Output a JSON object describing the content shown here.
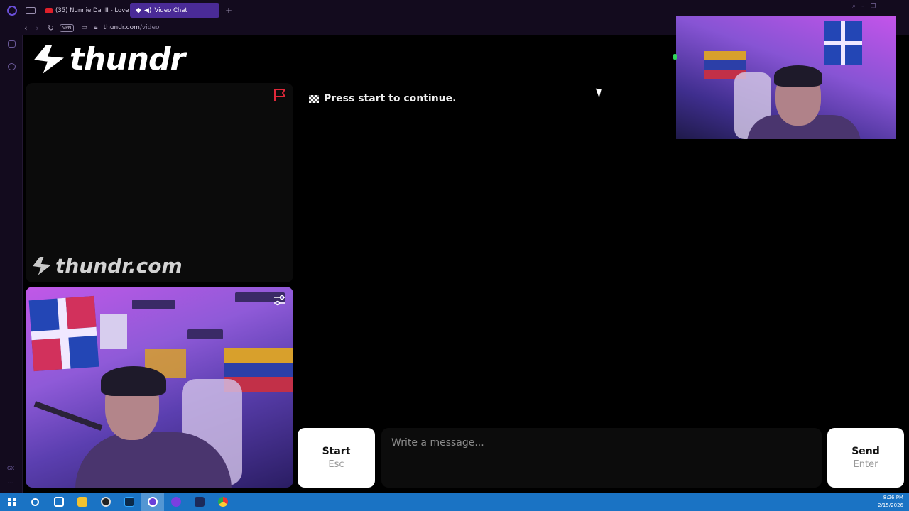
{
  "browser": {
    "tabs": [
      {
        "label": "(35) Nunnie Da III - Love N",
        "active": false
      },
      {
        "label": "Video Chat",
        "active": true
      }
    ],
    "new_tab_label": "+",
    "vpn_label": "VPN",
    "url_host": "thundr.com",
    "url_path": "/video"
  },
  "sidebar": {
    "gx_label": "GX",
    "more_label": "..."
  },
  "page": {
    "brand": "thundr",
    "watermark": "thundr.com",
    "status_text": "Press start to continue.",
    "start_button": {
      "label": "Start",
      "shortcut": "Esc"
    },
    "message_placeholder": "Write a message...",
    "send_button": {
      "label": "Send",
      "shortcut": "Enter"
    }
  },
  "taskbar": {
    "time": "8:26 PM",
    "date": "2/15/2026"
  },
  "colors": {
    "tab_active": "#4a2b97",
    "chrome_bg": "#130b1e",
    "report_flag": "#e0283a",
    "taskbar": "#1a73c4"
  }
}
